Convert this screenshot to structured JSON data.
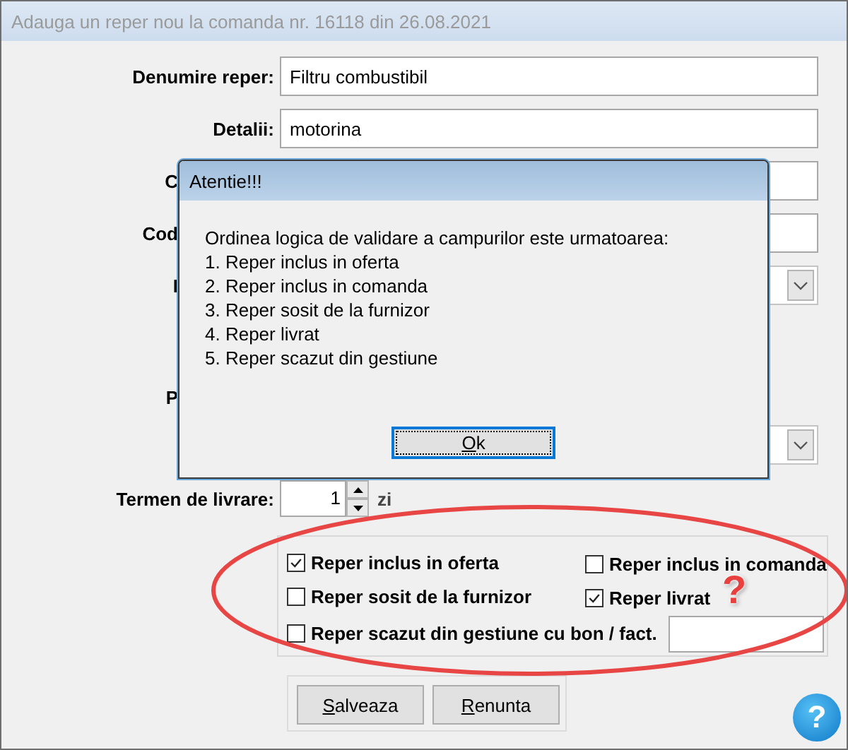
{
  "window": {
    "title": "Adauga un reper nou la comanda nr. 16118 din 26.08.2021"
  },
  "form_rows": [
    {
      "kind": "text",
      "label": "Denumire reper:",
      "value": "Filtru combustibil"
    },
    {
      "kind": "text",
      "label": "Detalii:",
      "value": "motorina"
    },
    {
      "kind": "covered_text",
      "label": "C"
    },
    {
      "kind": "covered_text",
      "label": "Cod"
    },
    {
      "kind": "covered_select",
      "label": "I"
    },
    {
      "kind": "covered_label",
      "label": "P"
    },
    {
      "kind": "covered_select"
    }
  ],
  "delivery": {
    "label": "Termen de livrare:",
    "value": "1",
    "unit": "zi"
  },
  "checkboxes": [
    {
      "label": "Reper inclus in oferta",
      "checked": true
    },
    {
      "label": "Reper inclus in comanda",
      "checked": false
    },
    {
      "label": "Reper sosit de la furnizor",
      "checked": false
    },
    {
      "label": "Reper livrat",
      "checked": true
    },
    {
      "label": "Reper scazut din gestiune cu bon / fact.",
      "checked": false
    }
  ],
  "buttons": [
    {
      "label": "Salveaza"
    },
    {
      "label": "Renunta"
    }
  ],
  "help_button": "?",
  "annotation": {
    "mark": "?"
  },
  "dialog": {
    "title": "Atentie!!!",
    "message_lines": [
      "Ordinea logica de validare a campurilor este urmatoarea:",
      "1. Reper inclus in oferta",
      "2. Reper inclus in comanda",
      "3. Reper sosit de la furnizor",
      "4. Reper livrat",
      "5. Reper scazut din gestiune"
    ],
    "button": {
      "label": "Ok"
    }
  }
}
